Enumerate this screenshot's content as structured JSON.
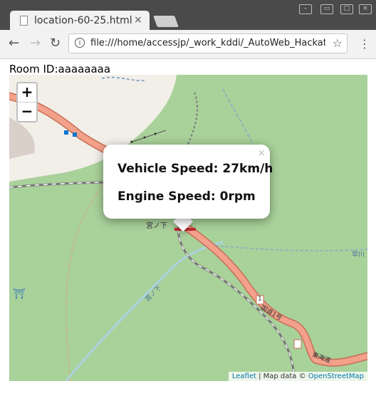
{
  "browser": {
    "tab_title": "location-60-25.html",
    "tab_close": "×",
    "url": "file:///home/accessjp/_work_kddi/_AutoWeb_Hackat"
  },
  "page": {
    "room_label": "Room ID:aaaaaaaa"
  },
  "map": {
    "zoom_in": "+",
    "zoom_out": "−",
    "popup": {
      "line1": "Vehicle Speed: 27km/h",
      "line2": "Engine Speed: 0rpm",
      "close": "×"
    },
    "labels": {
      "place1": "宮ノ下",
      "road_number": "1",
      "road_name": "国道1号",
      "road_name2": "東海道",
      "river": "早川",
      "place2": "宮ノ下"
    },
    "attribution": {
      "leaflet": "Leaflet",
      "sep": " | Map data © ",
      "osm": "OpenStreetMap"
    },
    "colors": {
      "forest": "#a9d19a",
      "land": "#f2efe9",
      "road": "#e8927c"
    }
  }
}
